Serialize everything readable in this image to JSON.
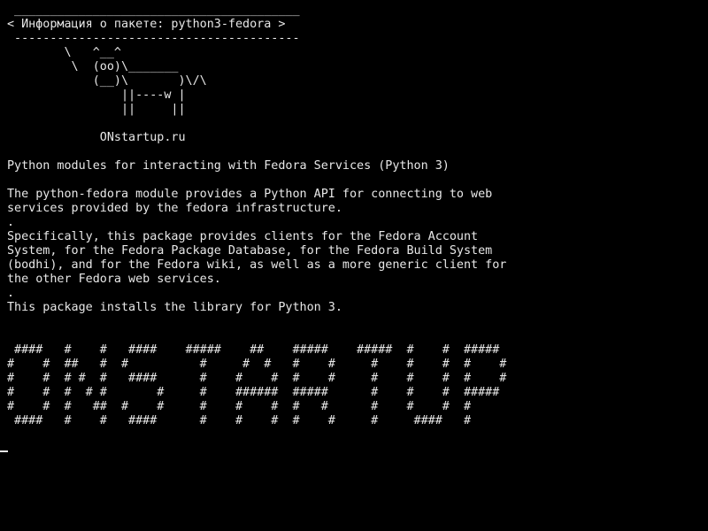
{
  "terminal": {
    "lines": [
      " ________________________________________",
      "< Информация о пакете: python3-fedora >",
      " ----------------------------------------",
      "        \\   ^__^",
      "         \\  (oo)\\_______",
      "            (__)\\       )\\/\\",
      "                ||----w |",
      "                ||     ||",
      "",
      "             ONstartup.ru",
      "",
      "Python modules for interacting with Fedora Services (Python 3)",
      "",
      "The python-fedora module provides a Python API for connecting to web",
      "services provided by the fedora infrastructure.",
      ".",
      "Specifically, this package provides clients for the Fedora Account",
      "System, for the Fedora Package Database, for the Fedora Build System",
      "(bodhi), and for the Fedora wiki, as well as a more generic client for",
      "the other Fedora web services.",
      ".",
      "This package installs the library for Python 3.",
      "",
      "",
      " ####   #    #   ####    #####    ##    #####    #####  #    #  #####",
      "#    #  ##   #  #          #     #  #   #    #     #    #    #  #    #",
      "#    #  # #  #   ####      #    #    #  #    #     #    #    #  #    #",
      "#    #  #  # #       #     #    ######  #####      #    #    #  #####",
      "#    #  #   ##  #    #     #    #    #  #   #      #    #    #  #",
      " ####   #    #   ####      #    #    #  #    #     #     ####   #"
    ]
  }
}
